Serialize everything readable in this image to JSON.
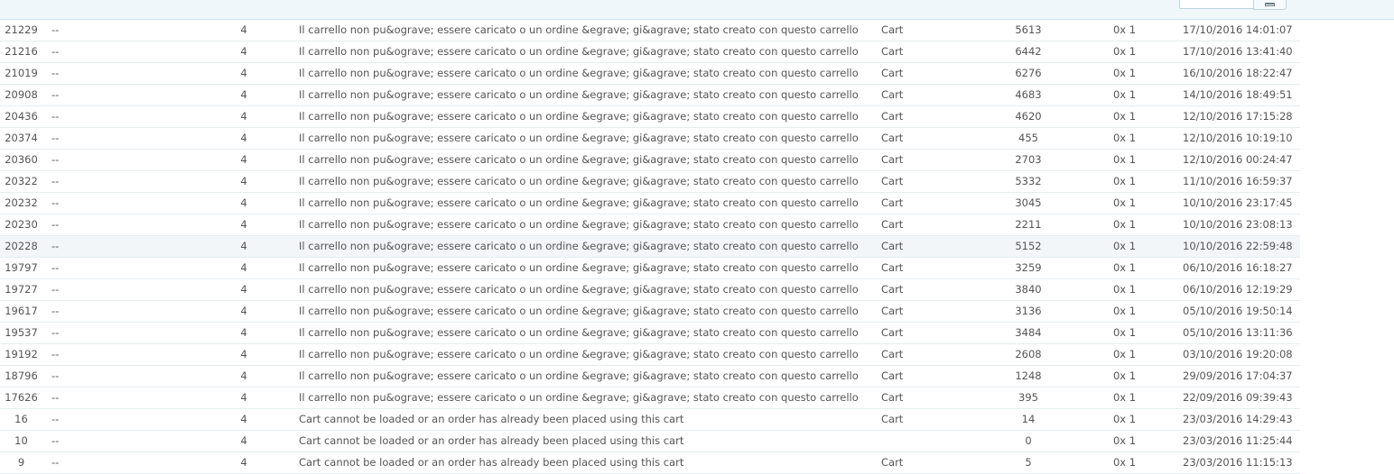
{
  "rows": [
    {
      "id": "21229",
      "employee": "--",
      "severity": "4",
      "message": "Il carrello non pu&ograve; essere caricato o un ordine &egrave; gi&agrave; stato creato con questo carrello",
      "object": "Cart",
      "object_id": "5613",
      "error_code": "0x 1",
      "date": "17/10/2016 14:01:07"
    },
    {
      "id": "21216",
      "employee": "--",
      "severity": "4",
      "message": "Il carrello non pu&ograve; essere caricato o un ordine &egrave; gi&agrave; stato creato con questo carrello",
      "object": "Cart",
      "object_id": "6442",
      "error_code": "0x 1",
      "date": "17/10/2016 13:41:40"
    },
    {
      "id": "21019",
      "employee": "--",
      "severity": "4",
      "message": "Il carrello non pu&ograve; essere caricato o un ordine &egrave; gi&agrave; stato creato con questo carrello",
      "object": "Cart",
      "object_id": "6276",
      "error_code": "0x 1",
      "date": "16/10/2016 18:22:47"
    },
    {
      "id": "20908",
      "employee": "--",
      "severity": "4",
      "message": "Il carrello non pu&ograve; essere caricato o un ordine &egrave; gi&agrave; stato creato con questo carrello",
      "object": "Cart",
      "object_id": "4683",
      "error_code": "0x 1",
      "date": "14/10/2016 18:49:51"
    },
    {
      "id": "20436",
      "employee": "--",
      "severity": "4",
      "message": "Il carrello non pu&ograve; essere caricato o un ordine &egrave; gi&agrave; stato creato con questo carrello",
      "object": "Cart",
      "object_id": "4620",
      "error_code": "0x 1",
      "date": "12/10/2016 17:15:28"
    },
    {
      "id": "20374",
      "employee": "--",
      "severity": "4",
      "message": "Il carrello non pu&ograve; essere caricato o un ordine &egrave; gi&agrave; stato creato con questo carrello",
      "object": "Cart",
      "object_id": "455",
      "error_code": "0x 1",
      "date": "12/10/2016 10:19:10"
    },
    {
      "id": "20360",
      "employee": "--",
      "severity": "4",
      "message": "Il carrello non pu&ograve; essere caricato o un ordine &egrave; gi&agrave; stato creato con questo carrello",
      "object": "Cart",
      "object_id": "2703",
      "error_code": "0x 1",
      "date": "12/10/2016 00:24:47"
    },
    {
      "id": "20322",
      "employee": "--",
      "severity": "4",
      "message": "Il carrello non pu&ograve; essere caricato o un ordine &egrave; gi&agrave; stato creato con questo carrello",
      "object": "Cart",
      "object_id": "5332",
      "error_code": "0x 1",
      "date": "11/10/2016 16:59:37"
    },
    {
      "id": "20232",
      "employee": "--",
      "severity": "4",
      "message": "Il carrello non pu&ograve; essere caricato o un ordine &egrave; gi&agrave; stato creato con questo carrello",
      "object": "Cart",
      "object_id": "3045",
      "error_code": "0x 1",
      "date": "10/10/2016 23:17:45"
    },
    {
      "id": "20230",
      "employee": "--",
      "severity": "4",
      "message": "Il carrello non pu&ograve; essere caricato o un ordine &egrave; gi&agrave; stato creato con questo carrello",
      "object": "Cart",
      "object_id": "2211",
      "error_code": "0x 1",
      "date": "10/10/2016 23:08:13"
    },
    {
      "id": "20228",
      "employee": "--",
      "severity": "4",
      "message": "Il carrello non pu&ograve; essere caricato o un ordine &egrave; gi&agrave; stato creato con questo carrello",
      "object": "Cart",
      "object_id": "5152",
      "error_code": "0x 1",
      "date": "10/10/2016 22:59:48",
      "highlighted": true
    },
    {
      "id": "19797",
      "employee": "--",
      "severity": "4",
      "message": "Il carrello non pu&ograve; essere caricato o un ordine &egrave; gi&agrave; stato creato con questo carrello",
      "object": "Cart",
      "object_id": "3259",
      "error_code": "0x 1",
      "date": "06/10/2016 16:18:27"
    },
    {
      "id": "19727",
      "employee": "--",
      "severity": "4",
      "message": "Il carrello non pu&ograve; essere caricato o un ordine &egrave; gi&agrave; stato creato con questo carrello",
      "object": "Cart",
      "object_id": "3840",
      "error_code": "0x 1",
      "date": "06/10/2016 12:19:29"
    },
    {
      "id": "19617",
      "employee": "--",
      "severity": "4",
      "message": "Il carrello non pu&ograve; essere caricato o un ordine &egrave; gi&agrave; stato creato con questo carrello",
      "object": "Cart",
      "object_id": "3136",
      "error_code": "0x 1",
      "date": "05/10/2016 19:50:14"
    },
    {
      "id": "19537",
      "employee": "--",
      "severity": "4",
      "message": "Il carrello non pu&ograve; essere caricato o un ordine &egrave; gi&agrave; stato creato con questo carrello",
      "object": "Cart",
      "object_id": "3484",
      "error_code": "0x 1",
      "date": "05/10/2016 13:11:36"
    },
    {
      "id": "19192",
      "employee": "--",
      "severity": "4",
      "message": "Il carrello non pu&ograve; essere caricato o un ordine &egrave; gi&agrave; stato creato con questo carrello",
      "object": "Cart",
      "object_id": "2608",
      "error_code": "0x 1",
      "date": "03/10/2016 19:20:08"
    },
    {
      "id": "18796",
      "employee": "--",
      "severity": "4",
      "message": "Il carrello non pu&ograve; essere caricato o un ordine &egrave; gi&agrave; stato creato con questo carrello",
      "object": "Cart",
      "object_id": "1248",
      "error_code": "0x 1",
      "date": "29/09/2016 17:04:37"
    },
    {
      "id": "17626",
      "employee": "--",
      "severity": "4",
      "message": "Il carrello non pu&ograve; essere caricato o un ordine &egrave; gi&agrave; stato creato con questo carrello",
      "object": "Cart",
      "object_id": "395",
      "error_code": "0x 1",
      "date": "22/09/2016 09:39:43"
    },
    {
      "id": "16",
      "employee": "--",
      "severity": "4",
      "message": "Cart cannot be loaded or an order has already been placed using this cart",
      "object": "Cart",
      "object_id": "14",
      "error_code": "0x 1",
      "date": "23/03/2016 14:29:43"
    },
    {
      "id": "10",
      "employee": "--",
      "severity": "4",
      "message": "Cart cannot be loaded or an order has already been placed using this cart",
      "object": "",
      "object_id": "0",
      "error_code": "0x 1",
      "date": "23/03/2016 11:25:44"
    },
    {
      "id": "9",
      "employee": "--",
      "severity": "4",
      "message": "Cart cannot be loaded or an order has already been placed using this cart",
      "object": "Cart",
      "object_id": "5",
      "error_code": "0x 1",
      "date": "23/03/2016 11:15:13"
    }
  ],
  "colors": {
    "text": "#555555",
    "row_border": "#e7edf0",
    "highlight_row": "#f3f6f8",
    "filter_bar": "#eff7fb"
  },
  "icons": {
    "calendar": "calendar-icon"
  }
}
